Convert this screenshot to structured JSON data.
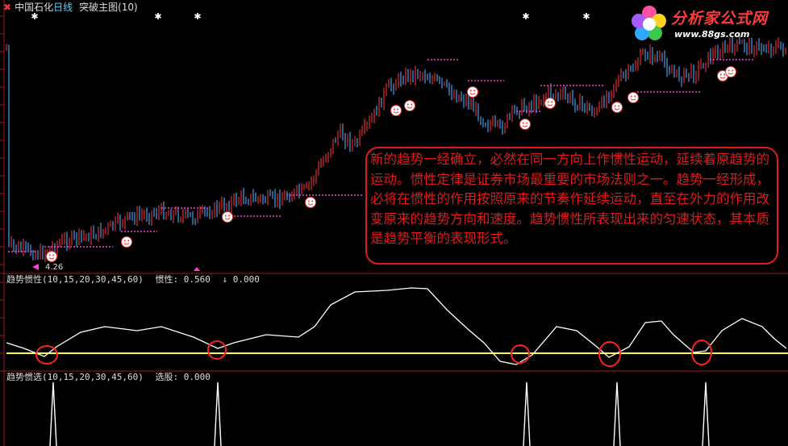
{
  "header": {
    "close_glyph": "✖",
    "stock_name": "中国石化",
    "period": "日线",
    "indicator": "突破主图(10)"
  },
  "main": {
    "low_price_label": "4.26"
  },
  "annotation": {
    "text": "新的趋势一经确立，必然在同一方向上作惯性运动，延续着原趋势的运动。惯性定律是证券市场最重要的市场法则之一。趋势一经形成，必将在惯性的作用按照原来的节奏作延续运动，直至在外力的作用改变原来的趋势方向和速度。趋势惯性所表现出来的匀速状态，其本质是趋势平衡的表现形式。"
  },
  "pane2": {
    "name": "趋势惯性(10,15,20,30,45,60)",
    "value_label": "惯性: 0.560",
    "value2": "↓ 0.000"
  },
  "pane3": {
    "name": "趋势惯选(10,15,20,30,45,60)",
    "value_label": "选股: 0.000"
  },
  "logo": {
    "brand": "分析家公式网",
    "site": "www.88gs.com"
  },
  "colors": {
    "up": "#e0303a",
    "down": "#4a9ee8",
    "ma": "#ff3ad8",
    "baseline": "#ffff33",
    "curve": "#ffffff",
    "circle": "#ff2020"
  }
}
